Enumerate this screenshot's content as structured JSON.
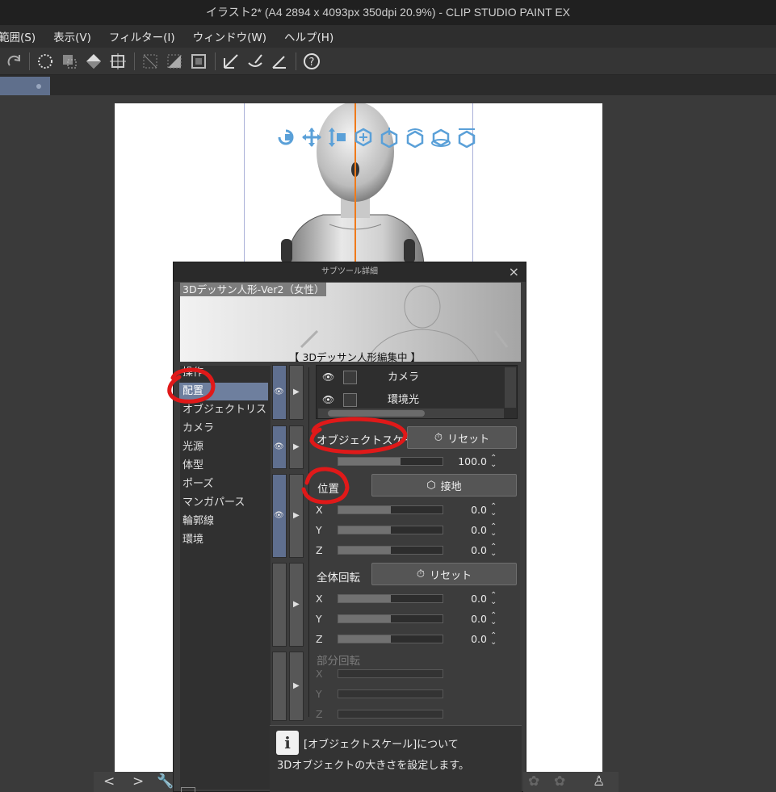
{
  "window": {
    "title": "イラスト2* (A4 2894 x 4093px 350dpi 20.9%)  - CLIP STUDIO PAINT EX"
  },
  "menu": [
    "範囲(S)",
    "表示(V)",
    "フィルター(I)",
    "ウィンドウ(W)",
    "ヘルプ(H)"
  ],
  "toolbar": {
    "icons": [
      "redo-icon",
      "select-all-icon",
      "transform-icon",
      "fill-icon",
      "crop-icon",
      "clear-icon",
      "fill-selection-icon",
      "deselect-icon",
      "tone-icon",
      "brush-selection-icon",
      "ruler-icon",
      "help-icon"
    ]
  },
  "subtool_panel": {
    "title": "サブツール詳細",
    "close_icon": "×",
    "preview_label": "3Dデッサン人形-Ver2（女性）",
    "preview_caption": "【 3Dデッサン人形編集中 】",
    "categories": [
      "操作",
      "配置",
      "オブジェクトリスト",
      "カメラ",
      "光源",
      "体型",
      "ポーズ",
      "マンガパース",
      "輪郭線",
      "環境"
    ],
    "selected_category": "配置",
    "object_list": [
      {
        "label": "カメラ"
      },
      {
        "label": "環境光"
      }
    ],
    "object_scale": {
      "label": "オブジェクトスケール",
      "reset_label": "リセット",
      "value": "100.0",
      "fraction": 0.6
    },
    "position": {
      "label": "位置",
      "ground_label": "接地",
      "x": {
        "label": "X",
        "value": "0.0",
        "fraction": 0.5
      },
      "y": {
        "label": "Y",
        "value": "0.0",
        "fraction": 0.5
      },
      "z": {
        "label": "Z",
        "value": "0.0",
        "fraction": 0.5
      }
    },
    "rotation": {
      "label": "全体回転",
      "reset_label": "リセット",
      "x": {
        "label": "X",
        "value": "0.0",
        "fraction": 0.5
      },
      "y": {
        "label": "Y",
        "value": "0.0",
        "fraction": 0.5
      },
      "z": {
        "label": "Z",
        "value": "0.0",
        "fraction": 0.5
      }
    },
    "partial_rotation": {
      "label": "部分回転",
      "x": {
        "label": "X"
      },
      "y": {
        "label": "Y"
      },
      "z": {
        "label": "Z"
      }
    },
    "help": {
      "line1": "[オブジェクトスケール]について",
      "line2": "3Dオブジェクトの大きさを設定します。"
    }
  },
  "colors": {
    "accent_selection": "#6e7f9e",
    "annotation": "#e01919",
    "model_blue": "#5aa0d8"
  }
}
